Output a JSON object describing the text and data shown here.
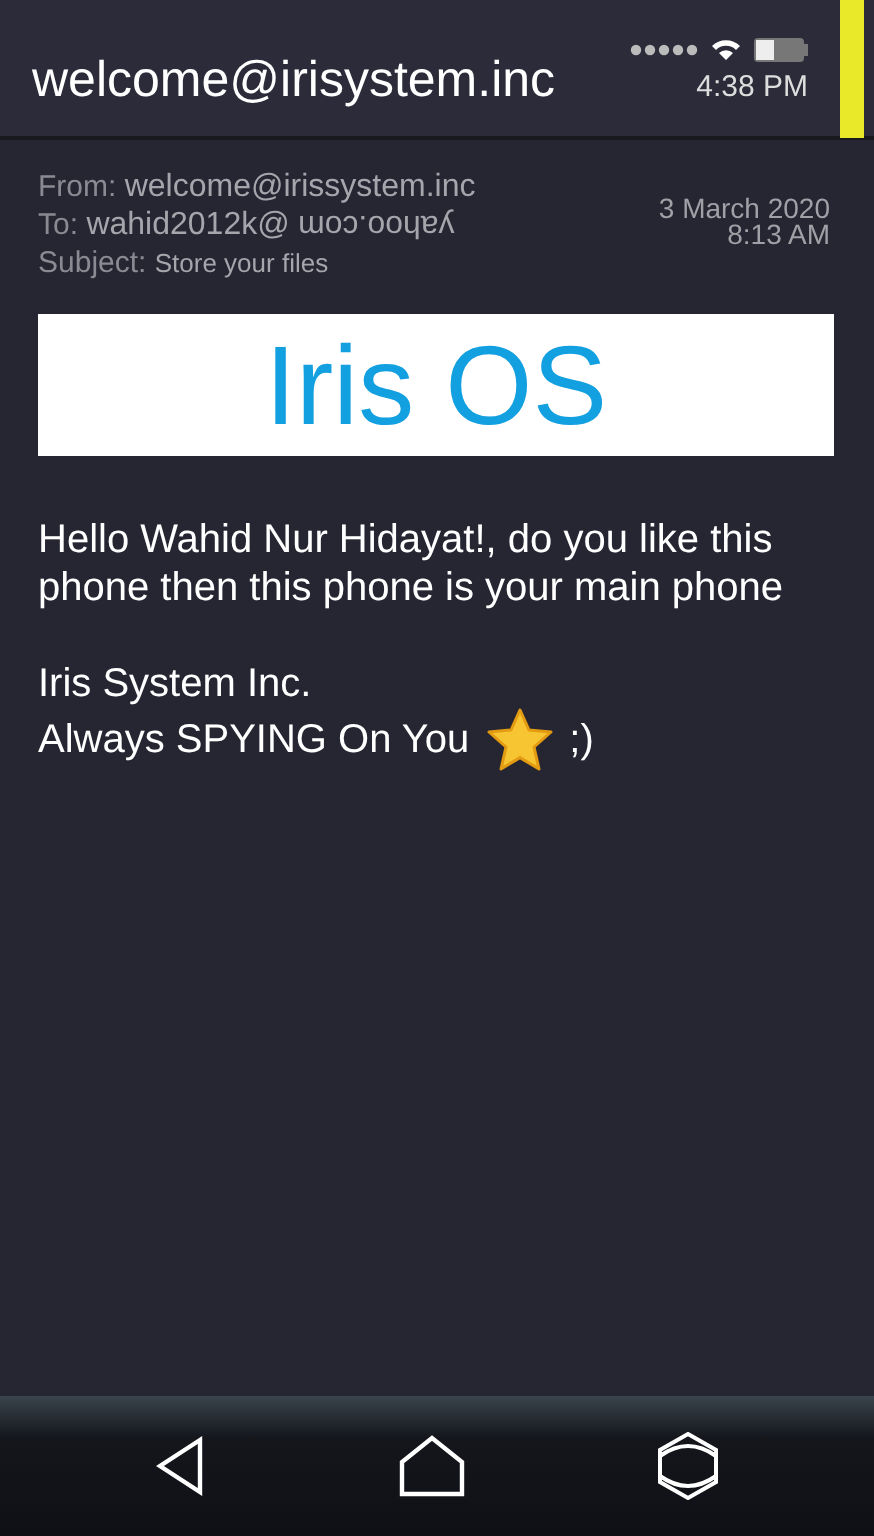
{
  "header": {
    "title": "welcome@irisystem.inc",
    "time": "4:38 PM"
  },
  "email": {
    "from_label": "From:",
    "from": "welcome@irissystem.inc",
    "to_label": "To:",
    "to_user": "wahid2012k@",
    "to_domain_upside_down": "yahoo.com",
    "subject_label": "Subject:",
    "subject": "Store your files",
    "date": "3 March 2020",
    "time": "8:13 AM"
  },
  "banner": {
    "title": "Iris OS"
  },
  "body": {
    "message": "Hello Wahid Nur Hidayat!, do you like this phone then this phone is your main phone",
    "signature": "Iris System Inc.",
    "closing": "Always SPYING On You",
    "smiley": ";)"
  }
}
